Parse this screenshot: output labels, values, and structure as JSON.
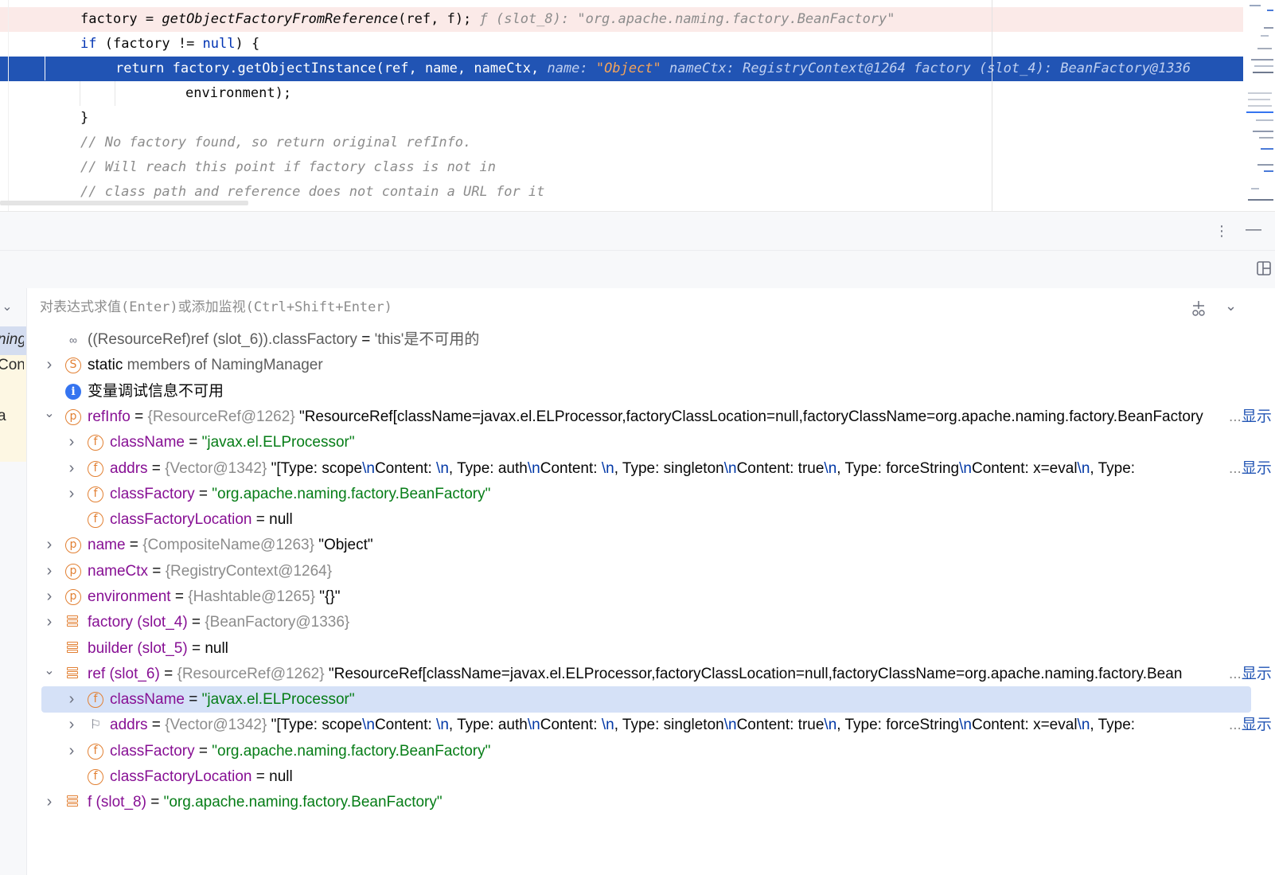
{
  "editor": {
    "lines": [
      {
        "parts": [
          {
            "t": "factory = ",
            "c": ""
          },
          {
            "t": "getObjectFactoryFromReference",
            "c": "it"
          },
          {
            "t": "(ref, f);",
            "c": ""
          },
          {
            "t": "  ƒ (slot_8): \"org.apache.naming.factory.BeanFactory\"",
            "c": "hint"
          }
        ]
      },
      {
        "parts": [
          {
            "t": "if",
            "c": "kw"
          },
          {
            "t": " (factory != ",
            "c": ""
          },
          {
            "t": "null",
            "c": "kw"
          },
          {
            "t": ") {",
            "c": ""
          }
        ]
      },
      {
        "parts": [
          {
            "t": "return",
            "c": "kw"
          },
          {
            "t": " factory.getObjectInstance(ref, name, nameCtx,",
            "c": ""
          },
          {
            "t": "  name: ",
            "c": "hint"
          },
          {
            "t": "\"Object\"",
            "c": "hint-str"
          },
          {
            "t": "    nameCtx: RegistryContext@1264    factory (slot_4): BeanFactory@1336",
            "c": "hint"
          }
        ]
      },
      {
        "parts": [
          {
            "t": "environment);",
            "c": ""
          }
        ]
      },
      {
        "parts": [
          {
            "t": "}",
            "c": ""
          }
        ]
      },
      {
        "parts": [
          {
            "t": "// No factory found, so return original refInfo.",
            "c": "cmt"
          }
        ]
      },
      {
        "parts": [
          {
            "t": "// Will reach this point if factory class is not in",
            "c": "cmt"
          }
        ]
      },
      {
        "parts": [
          {
            "t": "// class path and reference does not contain a URL for it",
            "c": "cmt"
          }
        ]
      }
    ]
  },
  "toolbar": {
    "more_icon": "kebab-icon",
    "minimize_icon": "minimize-icon",
    "layout_icon": "layout-icon"
  },
  "expression": {
    "placeholder": "对表达式求值(Enter)或添加监视(Ctrl+Shift+Enter)",
    "value": ""
  },
  "frames": {
    "items": [
      "ning",
      "Con",
      "a"
    ]
  },
  "variables": {
    "more_label": "显示",
    "rows": [
      {
        "icon": "watch",
        "expand": "",
        "parts": [
          {
            "t": "((ResourceRef)ref (slot_6)).classFactory",
            "c": "muted"
          },
          {
            "t": " = ",
            "c": "eq"
          },
          {
            "t": "'this'是不可用的",
            "c": "muted"
          }
        ]
      },
      {
        "icon": "s",
        "expand": "collapsed",
        "parts": [
          {
            "t": "static",
            "c": "n plain"
          },
          {
            "t": " members of NamingManager",
            "c": "muted"
          }
        ]
      },
      {
        "icon": "info",
        "expand": "",
        "parts": [
          {
            "t": "变量调试信息不可用",
            "c": "n plain"
          }
        ]
      },
      {
        "icon": "p",
        "expand": "expanded",
        "more": true,
        "parts": [
          {
            "t": "refInfo",
            "c": "n"
          },
          {
            "t": " = ",
            "c": "eq"
          },
          {
            "t": "{ResourceRef@1262}",
            "c": "ref"
          },
          {
            "t": " \"ResourceRef[className=javax.el.ELProcessor,factoryClassLocation=null,factoryClassName=org.apache.naming.factory.BeanFactory",
            "c": "n plain"
          }
        ]
      },
      {
        "icon": "f",
        "level": 1,
        "expand": "collapsed",
        "parts": [
          {
            "t": "className",
            "c": "n"
          },
          {
            "t": " = ",
            "c": "eq"
          },
          {
            "t": "\"javax.el.ELProcessor\"",
            "c": "str"
          }
        ]
      },
      {
        "icon": "f",
        "level": 1,
        "expand": "collapsed",
        "more": true,
        "parts": [
          {
            "t": "addrs",
            "c": "n"
          },
          {
            "t": " = ",
            "c": "eq"
          },
          {
            "t": "{Vector@1342}",
            "c": "ref"
          },
          {
            "t": " \"[Type: scope",
            "c": "n plain"
          },
          {
            "t": "\\n",
            "c": "esc"
          },
          {
            "t": "Content: ",
            "c": "n plain"
          },
          {
            "t": "\\n",
            "c": "esc"
          },
          {
            "t": ", Type: auth",
            "c": "n plain"
          },
          {
            "t": "\\n",
            "c": "esc"
          },
          {
            "t": "Content: ",
            "c": "n plain"
          },
          {
            "t": "\\n",
            "c": "esc"
          },
          {
            "t": ", Type: singleton",
            "c": "n plain"
          },
          {
            "t": "\\n",
            "c": "esc"
          },
          {
            "t": "Content: true",
            "c": "n plain"
          },
          {
            "t": "\\n",
            "c": "esc"
          },
          {
            "t": ", Type: forceString",
            "c": "n plain"
          },
          {
            "t": "\\n",
            "c": "esc"
          },
          {
            "t": "Content: x=eval",
            "c": "n plain"
          },
          {
            "t": "\\n",
            "c": "esc"
          },
          {
            "t": ", Type: ",
            "c": "n plain"
          }
        ]
      },
      {
        "icon": "f",
        "level": 1,
        "expand": "collapsed",
        "parts": [
          {
            "t": "classFactory",
            "c": "n"
          },
          {
            "t": " = ",
            "c": "eq"
          },
          {
            "t": "\"org.apache.naming.factory.BeanFactory\"",
            "c": "str"
          }
        ]
      },
      {
        "icon": "f",
        "level": 1,
        "expand": "",
        "parts": [
          {
            "t": "classFactoryLocation",
            "c": "n"
          },
          {
            "t": " = ",
            "c": "eq"
          },
          {
            "t": "null",
            "c": "n plain"
          }
        ]
      },
      {
        "icon": "p",
        "expand": "collapsed",
        "parts": [
          {
            "t": "name",
            "c": "n"
          },
          {
            "t": " = ",
            "c": "eq"
          },
          {
            "t": "{CompositeName@1263}",
            "c": "ref"
          },
          {
            "t": " \"Object\"",
            "c": "n plain"
          }
        ]
      },
      {
        "icon": "p",
        "expand": "collapsed",
        "parts": [
          {
            "t": "nameCtx",
            "c": "n"
          },
          {
            "t": " = ",
            "c": "eq"
          },
          {
            "t": "{RegistryContext@1264}",
            "c": "ref"
          }
        ]
      },
      {
        "icon": "p",
        "expand": "collapsed",
        "parts": [
          {
            "t": "environment",
            "c": "n"
          },
          {
            "t": " = ",
            "c": "eq"
          },
          {
            "t": "{Hashtable@1265}",
            "c": "ref"
          },
          {
            "t": " \"{}\"",
            "c": "n plain"
          }
        ]
      },
      {
        "icon": "local",
        "expand": "collapsed",
        "parts": [
          {
            "t": "factory (slot_4)",
            "c": "n"
          },
          {
            "t": " = ",
            "c": "eq"
          },
          {
            "t": "{BeanFactory@1336}",
            "c": "ref"
          }
        ]
      },
      {
        "icon": "local",
        "expand": "",
        "parts": [
          {
            "t": "builder (slot_5)",
            "c": "n"
          },
          {
            "t": " = ",
            "c": "eq"
          },
          {
            "t": "null",
            "c": "n plain"
          }
        ]
      },
      {
        "icon": "local",
        "expand": "expanded",
        "more": true,
        "parts": [
          {
            "t": "ref (slot_6)",
            "c": "n"
          },
          {
            "t": " = ",
            "c": "eq"
          },
          {
            "t": "{ResourceRef@1262}",
            "c": "ref"
          },
          {
            "t": " \"ResourceRef[className=javax.el.ELProcessor,factoryClassLocation=null,factoryClassName=org.apache.naming.factory.Bean",
            "c": "n plain"
          }
        ]
      },
      {
        "icon": "f",
        "level": 1,
        "expand": "collapsed",
        "selected": true,
        "parts": [
          {
            "t": "className",
            "c": "n"
          },
          {
            "t": " = ",
            "c": "eq"
          },
          {
            "t": "\"javax.el.ELProcessor\"",
            "c": "str"
          }
        ]
      },
      {
        "icon": "flag",
        "level": 1,
        "expand": "collapsed",
        "more": true,
        "parts": [
          {
            "t": "addrs",
            "c": "n"
          },
          {
            "t": " = ",
            "c": "eq"
          },
          {
            "t": "{Vector@1342}",
            "c": "ref"
          },
          {
            "t": " \"[Type: scope",
            "c": "n plain"
          },
          {
            "t": "\\n",
            "c": "esc"
          },
          {
            "t": "Content: ",
            "c": "n plain"
          },
          {
            "t": "\\n",
            "c": "esc"
          },
          {
            "t": ", Type: auth",
            "c": "n plain"
          },
          {
            "t": "\\n",
            "c": "esc"
          },
          {
            "t": "Content: ",
            "c": "n plain"
          },
          {
            "t": "\\n",
            "c": "esc"
          },
          {
            "t": ", Type: singleton",
            "c": "n plain"
          },
          {
            "t": "\\n",
            "c": "esc"
          },
          {
            "t": "Content: true",
            "c": "n plain"
          },
          {
            "t": "\\n",
            "c": "esc"
          },
          {
            "t": ", Type: forceString",
            "c": "n plain"
          },
          {
            "t": "\\n",
            "c": "esc"
          },
          {
            "t": "Content: x=eval",
            "c": "n plain"
          },
          {
            "t": "\\n",
            "c": "esc"
          },
          {
            "t": ", Type: ",
            "c": "n plain"
          }
        ]
      },
      {
        "icon": "f",
        "level": 1,
        "expand": "collapsed",
        "parts": [
          {
            "t": "classFactory",
            "c": "n"
          },
          {
            "t": " = ",
            "c": "eq"
          },
          {
            "t": "\"org.apache.naming.factory.BeanFactory\"",
            "c": "str"
          }
        ]
      },
      {
        "icon": "f",
        "level": 1,
        "expand": "",
        "parts": [
          {
            "t": "classFactoryLocation",
            "c": "n"
          },
          {
            "t": " = ",
            "c": "eq"
          },
          {
            "t": "null",
            "c": "n plain"
          }
        ]
      },
      {
        "icon": "local",
        "expand": "collapsed",
        "parts": [
          {
            "t": "f (slot_8)",
            "c": "n"
          },
          {
            "t": " = ",
            "c": "eq"
          },
          {
            "t": "\"org.apache.naming.factory.BeanFactory\"",
            "c": "str"
          }
        ]
      }
    ]
  }
}
